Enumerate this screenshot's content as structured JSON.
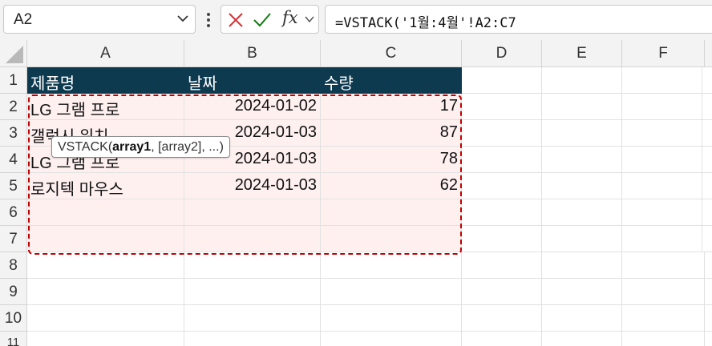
{
  "name_box": {
    "value": "A2"
  },
  "formula_bar": {
    "formula": "=VSTACK('1월:4월'!A2:C7",
    "fx_label": "fx"
  },
  "columns": [
    "A",
    "B",
    "C",
    "D",
    "E",
    "F"
  ],
  "rows": [
    "1",
    "2",
    "3",
    "4",
    "5",
    "6",
    "7",
    "8",
    "9",
    "10",
    "11"
  ],
  "table": {
    "headers": [
      "제품명",
      "날짜",
      "수량"
    ],
    "rows": [
      [
        "LG 그램 프로",
        "2024-01-02",
        "17"
      ],
      [
        "갤럭시 워치",
        "2024-01-03",
        "87"
      ],
      [
        "LG 그램 프로",
        "2024-01-03",
        "78"
      ],
      [
        "로지텍 마우스",
        "2024-01-03",
        "62"
      ]
    ]
  },
  "tooltip": {
    "func": "VSTACK(",
    "arg1": "array1",
    "rest": ", [array2], ...)"
  },
  "colors": {
    "header_fill": "#0e3a4f",
    "spill_fill": "#fff0f0",
    "spill_border": "#c00000",
    "cancel": "#d13438",
    "enter": "#107c10"
  }
}
